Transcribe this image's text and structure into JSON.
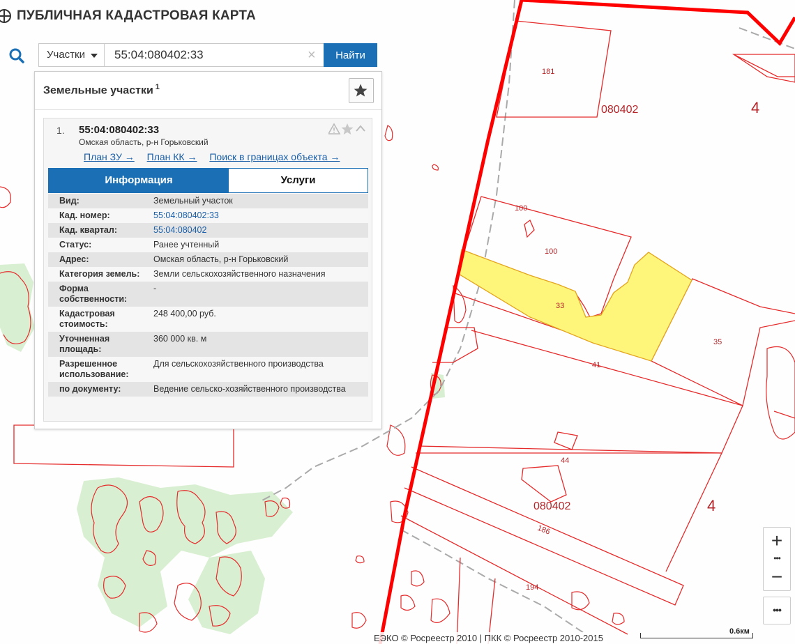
{
  "app": {
    "title": "ПУБЛИЧНАЯ КАДАСТРОВАЯ КАРТА"
  },
  "search": {
    "type_label": "Участки",
    "query": "55:04:080402:33",
    "button_label": "Найти"
  },
  "panel": {
    "title": "Земельные участки",
    "count": "1"
  },
  "result": {
    "index": "1.",
    "number": "55:04:080402:33",
    "address": "Омская область, р-н Горьковский",
    "links": [
      "План ЗУ →",
      "План КК →",
      "Поиск в границах объекта →"
    ],
    "tabs": {
      "info": "Информация",
      "services": "Услуги"
    },
    "properties": [
      {
        "key": "Вид:",
        "value": "Земельный участок"
      },
      {
        "key": "Кад. номер:",
        "value": "55:04:080402:33"
      },
      {
        "key": "Кад. квартал:",
        "value": "55:04:080402"
      },
      {
        "key": "Статус:",
        "value": "Ранее учтенный"
      },
      {
        "key": "Адрес:",
        "value": "Омская область, р-н Горьковский"
      },
      {
        "key": "Категория земель:",
        "value": "Земли сельскохозяйственного назначения"
      },
      {
        "key": "Форма собственности:",
        "value": "-"
      },
      {
        "key": "Кадастровая стоимость:",
        "value": "248 400,00 руб."
      },
      {
        "key": "Уточненная площадь:",
        "value": "360 000 кв. м"
      },
      {
        "key": "Разрешенное использование:",
        "value": "Для сельскохозяйственного производства"
      },
      {
        "key": "по документу:",
        "value": "Ведение сельско-хозяйственного производства"
      }
    ]
  },
  "map": {
    "labels": {
      "p181": "181",
      "q1": "080402",
      "d1": "4",
      "p100a": "100",
      "p100b": "100",
      "p33": "33",
      "p35": "35",
      "p41": "41",
      "p44": "44",
      "q2": "080402",
      "d2": "4",
      "p186": "186",
      "p194": "194"
    },
    "colors": {
      "parcel": "#e52b2b",
      "district": "#ff0000",
      "selected": "#fdf67a",
      "forest": "#d9efd2"
    }
  },
  "controls": {
    "zoom_in": "+",
    "zoom_out": "−",
    "more": "•••"
  },
  "footer": {
    "attribution": "ЕЭКО © Росреестр 2010 | ПКК © Росреестр 2010-2015",
    "scale": "0.6км"
  }
}
